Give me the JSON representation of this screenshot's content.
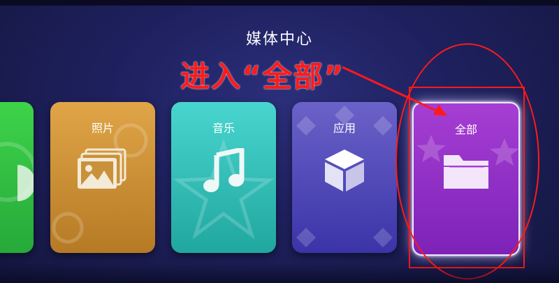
{
  "header": {
    "title": "媒体中心"
  },
  "annotation": {
    "text": "进入“全部”",
    "color": "#ff1a1a"
  },
  "cards": [
    {
      "label": "",
      "icon": "partial-green-icon",
      "color": "#3ed34a"
    },
    {
      "label": "照片",
      "icon": "photos-icon",
      "color": "#e0a547"
    },
    {
      "label": "音乐",
      "icon": "music-note-icon",
      "color": "#49d5cf"
    },
    {
      "label": "应用",
      "icon": "cube-icon",
      "color": "#6b62c8"
    },
    {
      "label": "全部",
      "icon": "folder-icon",
      "color": "#a63ed3",
      "selected": true
    }
  ]
}
